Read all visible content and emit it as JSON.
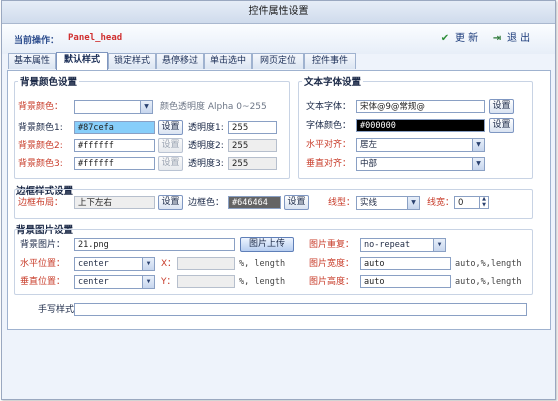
{
  "window": {
    "title": "控件属性设置"
  },
  "operation": {
    "label": "当前操作：",
    "value": "Panel_head"
  },
  "toolbar": {
    "update_label": "更 新",
    "exit_label": "退 出",
    "colors": {
      "accent_blue": "#2f4f8f",
      "danger_red": "#d03030",
      "check_green": "#2f8f3a"
    }
  },
  "tabs": [
    {
      "label": "基本属性"
    },
    {
      "label": "默认样式",
      "active": true
    },
    {
      "label": "锁定样式"
    },
    {
      "label": "悬停移过"
    },
    {
      "label": "单击选中"
    },
    {
      "label": "网页定位"
    },
    {
      "label": "控件事件"
    }
  ],
  "bg_color_section": {
    "title": "背景颜色设置",
    "bg_label": "背景颜色：",
    "bg_select": "",
    "alpha_note": "颜色透明度 Alpha 0~255",
    "rows": [
      {
        "label": "背景颜色1:",
        "value": "#87cefa",
        "swatch": "#87cefa",
        "btn": "设置",
        "alpha_label": "透明度1:",
        "alpha": "255"
      },
      {
        "label": "背景颜色2:",
        "value": "#ffffff",
        "btn": "设置",
        "alpha_label": "透明度2:",
        "alpha": "255"
      },
      {
        "label": "背景颜色3:",
        "value": "#ffffff",
        "btn": "设置",
        "alpha_label": "透明度3:",
        "alpha": "255"
      }
    ]
  },
  "text_font_section": {
    "title": "文本字体设置",
    "font_label": "文本字体：",
    "font_value": "宋体@9@常规@",
    "font_btn": "设置",
    "color_label": "字体颜色：",
    "color_value": "#000000",
    "color_swatch": "#000000",
    "color_btn": "设置",
    "halign_label": "水平对齐：",
    "halign_value": "居左",
    "valign_label": "垂直对齐：",
    "valign_value": "中部"
  },
  "border_section": {
    "title": "边框样式设置",
    "layout_label": "边框布局：",
    "layout_value": "上下左右",
    "layout_btn": "设置",
    "color_label": "边框色：",
    "color_value": "#646464",
    "color_swatch": "#646464",
    "color_btn": "设置",
    "line_label": "线型：",
    "line_value": "实线",
    "width_label": "线宽：",
    "width_value": "0"
  },
  "bg_image_section": {
    "title": "背景图片设置",
    "image_label": "背景图片：",
    "image_value": "21.png",
    "upload_btn": "图片上传",
    "repeat_label": "图片重复：",
    "repeat_value": "no-repeat",
    "hpos_label": "水平位置：",
    "hpos_value": "center",
    "x_label": "X：",
    "x_value": "",
    "x_unit": "%, length",
    "img_w_label": "图片宽度：",
    "img_w_value": "auto",
    "img_w_unit": "auto,%,length",
    "vpos_label": "垂直位置：",
    "vpos_value": "center",
    "y_label": "Y：",
    "y_value": "",
    "y_unit": "%, length",
    "img_h_label": "图片高度：",
    "img_h_value": "auto",
    "img_h_unit": "auto,%,length"
  },
  "handwrite": {
    "label": "手写样式：",
    "value": ""
  }
}
